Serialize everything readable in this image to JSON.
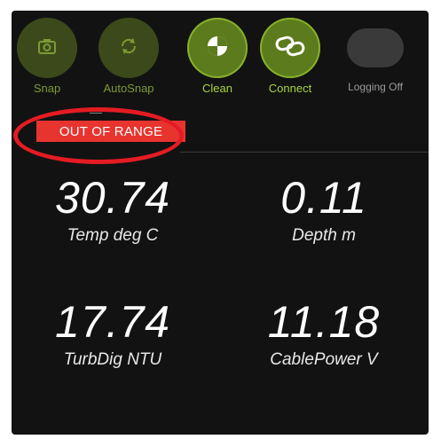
{
  "toolbar": {
    "buttons": [
      {
        "label": "Snap",
        "icon": "camera-icon"
      },
      {
        "label": "AutoSnap",
        "icon": "refresh-icon"
      },
      {
        "label": "Clean",
        "icon": "wiper-icon"
      },
      {
        "label": "Connect",
        "icon": "link-icon"
      },
      {
        "label": "Logging Off",
        "icon": "toggle-icon"
      }
    ]
  },
  "status": {
    "badge": "OUT OF RANGE",
    "badge_color": "#e8342f",
    "highlight_color": "#e51b23"
  },
  "readings": [
    {
      "value": "30.74",
      "unit": "Temp deg C"
    },
    {
      "value": "0.11",
      "unit": "Depth m"
    },
    {
      "value": "17.74",
      "unit": "TurbDig NTU"
    },
    {
      "value": "11.18",
      "unit": "CablePower V"
    }
  ],
  "colors": {
    "accent": "#a7d23c",
    "background": "#121212"
  }
}
